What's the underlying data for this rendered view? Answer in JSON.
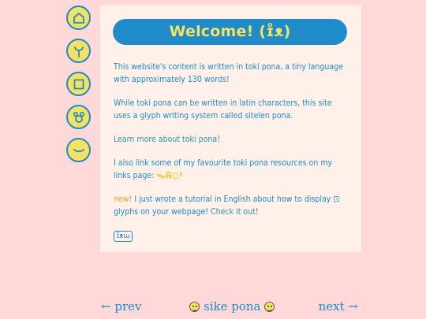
{
  "sidebar": {
    "icons": [
      "home-icon",
      "sprout-icon",
      "square-icon",
      "bear-icon",
      "smile-icon"
    ]
  },
  "banner": {
    "title": "Welcome! (ɪ̊ᴥ)"
  },
  "main": {
    "p1": "This website's content is written in toki pona, a tiny language with approximately 130 words!",
    "p2": "While toki pona can be written in latin characters, this site uses a glyph writing system called sitelen pona.",
    "learn_link": "Learn more about toki pona!",
    "p4_text": "I also link some of my favourite toki pona resources on my links page:",
    "p4_glyphs": "ᯓᕱ◻ᵡ",
    "new_label": "new!",
    "p5_text": "I just wrote a tutorial in English about how to display",
    "p5_text2": "glyphs on your webpage!",
    "checkout_link": "Check it out!",
    "badge": "ɪ̊ᴥɯ"
  },
  "bottom_nav": {
    "prev": "← prev",
    "center": "sike pona",
    "next": "next →"
  },
  "colors": {
    "background": "#ffd9d9",
    "card": "#fff0ea",
    "accent": "#1f8bc9",
    "yellow": "#f5e263",
    "new": "#ef9a3a"
  }
}
